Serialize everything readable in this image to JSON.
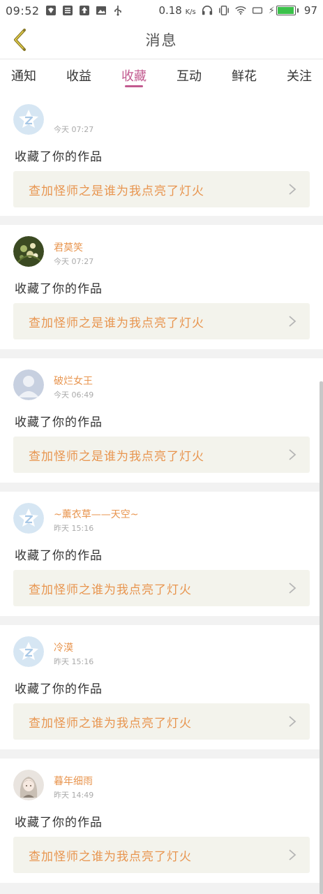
{
  "status_bar": {
    "time": "09:52",
    "speed": "0.18",
    "speed_unit": "K/s",
    "battery": "97",
    "battery_level": 0.97,
    "icons": [
      "shield-icon",
      "list-icon",
      "upload-icon",
      "image-icon",
      "usb-icon",
      "headphones-icon",
      "vibrate-icon",
      "wifi-icon",
      "cast-icon",
      "charging-icon",
      "battery-icon"
    ]
  },
  "header": {
    "title": "消息",
    "back_icon": "chevron-left-icon"
  },
  "tabs": [
    {
      "label": "通知"
    },
    {
      "label": "收益"
    },
    {
      "label": "收藏"
    },
    {
      "label": "互动"
    },
    {
      "label": "鲜花"
    },
    {
      "label": "关注"
    }
  ],
  "active_tab": "收藏",
  "colors": {
    "accent_pink": "#c25a8f",
    "orange_text": "#e8954f",
    "card_bg": "#f3f3ec",
    "green_battery": "#3bc14a"
  },
  "items": [
    {
      "nickname": "",
      "time": "今天 07:27",
      "action": "收藏了你的作品",
      "work_title": "查加怪师之是谁为我点亮了灯火",
      "avatar": "default-star-avatar"
    },
    {
      "nickname": "君莫笑",
      "time": "今天 07:27",
      "action": "收藏了你的作品",
      "work_title": "查加怪师之是谁为我点亮了灯火",
      "avatar": "flower-photo-avatar"
    },
    {
      "nickname": "破烂女王",
      "time": "今天 06:49",
      "action": "收藏了你的作品",
      "work_title": "查加怪师之是谁为我点亮了灯火",
      "avatar": "default-person-avatar"
    },
    {
      "nickname": "~薰衣草——天空~",
      "time": "昨天 15:16",
      "action": "收藏了你的作品",
      "work_title": "查加怪师之谁为我点亮了灯火",
      "avatar": "default-star-avatar"
    },
    {
      "nickname": "冷漠",
      "time": "昨天 15:16",
      "action": "收藏了你的作品",
      "work_title": "查加怪师之谁为我点亮了灯火",
      "avatar": "default-star-avatar"
    },
    {
      "nickname": "暮年细雨",
      "time": "昨天 14:49",
      "action": "收藏了你的作品",
      "work_title": "查加怪师之谁为我点亮了灯火",
      "avatar": "anime-girl-avatar"
    }
  ]
}
